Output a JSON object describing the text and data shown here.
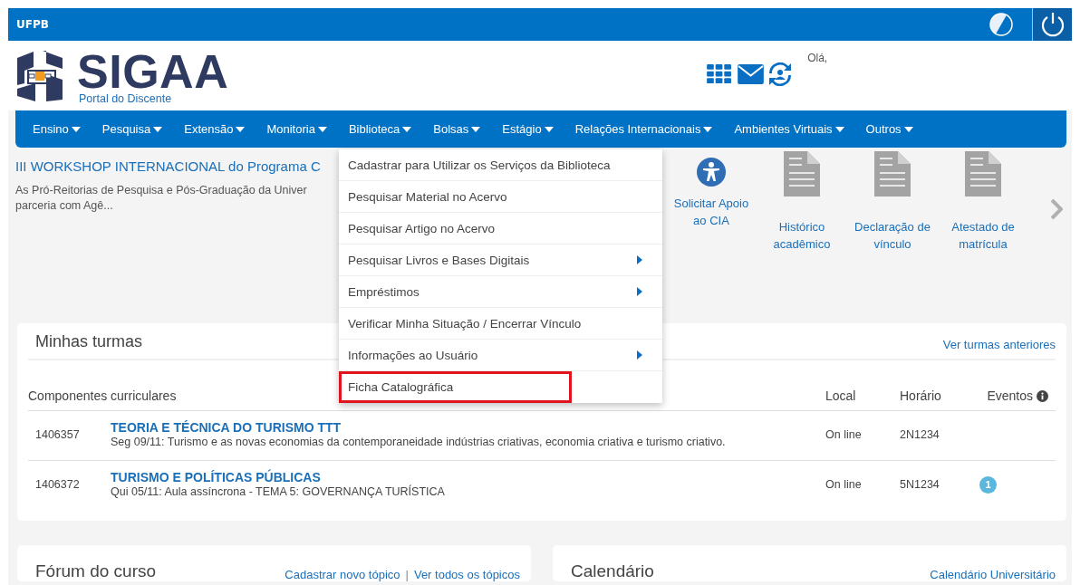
{
  "top_bar": {
    "title": "UFPB"
  },
  "header": {
    "logo_text": "SIGAA",
    "subtitle": "Portal do Discente",
    "greeting": "Olá,"
  },
  "nav": [
    "Ensino",
    "Pesquisa",
    "Extensão",
    "Monitoria",
    "Biblioteca",
    "Bolsas",
    "Estágio",
    "Relações Internacionais",
    "Ambientes Virtuais",
    "Outros"
  ],
  "news": {
    "title": "III WORKSHOP INTERNACIONAL do Programa C",
    "lines": [
      "As Pró-Reitorias de Pesquisa e Pós-Graduação da Univer",
      "parceria com Agê..."
    ]
  },
  "shortcuts": [
    {
      "kind": "accessibility",
      "lines": [
        "Solicitar Apoio",
        "ao CIA"
      ]
    },
    {
      "kind": "document",
      "lines": [
        "Histórico",
        "acadêmico"
      ]
    },
    {
      "kind": "document",
      "lines": [
        "Declaração de",
        "vínculo"
      ]
    },
    {
      "kind": "document",
      "lines": [
        "Atestado de",
        "matrícula"
      ]
    }
  ],
  "menu": {
    "items": [
      {
        "label": "Cadastrar para Utilizar os Serviços da Biblioteca",
        "kind": "plain",
        "highlighted": false
      },
      {
        "label": "Pesquisar Material no Acervo",
        "kind": "plain",
        "highlighted": false
      },
      {
        "label": "Pesquisar Artigo no Acervo",
        "kind": "plain",
        "highlighted": false
      },
      {
        "label": "Pesquisar Livros e Bases Digitais",
        "kind": "submenu",
        "highlighted": false
      },
      {
        "label": "Empréstimos",
        "kind": "submenu",
        "highlighted": false
      },
      {
        "label": "Verificar Minha Situação / Encerrar Vínculo",
        "kind": "plain",
        "highlighted": false
      },
      {
        "label": "Informações ao Usuário",
        "kind": "submenu",
        "highlighted": false
      },
      {
        "label": "Ficha Catalográfica",
        "kind": "plain",
        "highlighted": true
      }
    ]
  },
  "turmas": {
    "title": "Minhas turmas",
    "link": "Ver turmas anteriores",
    "columns": [
      "Componentes curriculares",
      "Local",
      "Horário",
      "Eventos"
    ],
    "rows": [
      {
        "code": "1406357",
        "name": "TEORIA E TÉCNICA DO TURISMO TTT",
        "description": "Seg 09/11: Turismo e as novas economias da contemporaneidade indústrias criativas, economia criativa e turismo criativo.",
        "local": "On line",
        "horario": "2N1234"
      },
      {
        "code": "1406372",
        "name": "TURISMO E POLÍTICAS PÚBLICAS",
        "description": "Qui 05/11: Aula assíncrona - TEMA 5: GOVERNANÇA TURÍSTICA",
        "local": "On line",
        "horario": "5N1234",
        "eventos": "1"
      }
    ]
  },
  "forum": {
    "title": "Fórum do curso",
    "links": [
      "Cadastrar novo tópico",
      "Ver todos os tópicos"
    ],
    "separator": "|"
  },
  "calendar": {
    "title": "Calendário",
    "link": "Calendário Universitário"
  }
}
